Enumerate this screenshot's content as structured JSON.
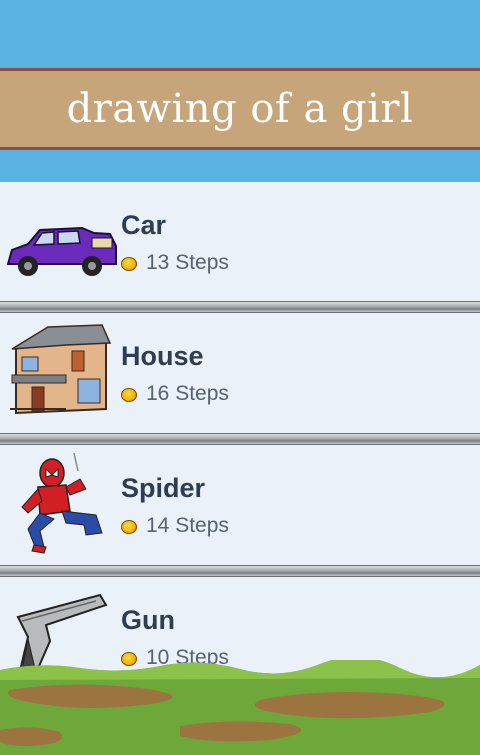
{
  "header": {
    "title": "drawing of a girl"
  },
  "items": [
    {
      "name": "Car",
      "steps": "13 Steps",
      "icon": "car-icon"
    },
    {
      "name": "House",
      "steps": "16 Steps",
      "icon": "house-icon"
    },
    {
      "name": "Spider",
      "steps": "14 Steps",
      "icon": "spiderman-icon"
    },
    {
      "name": "Gun",
      "steps": "10 Steps",
      "icon": "pistol-icon"
    }
  ],
  "colors": {
    "sky": "#5ab3e3",
    "banner": "#c7a57a",
    "banner_border": "#8a4f45",
    "list_bg": "#eaf1f9",
    "item_title": "#2e3d4f",
    "coin": "#f0b400",
    "grass": "#6ea83a",
    "dirt": "#9b7440"
  }
}
